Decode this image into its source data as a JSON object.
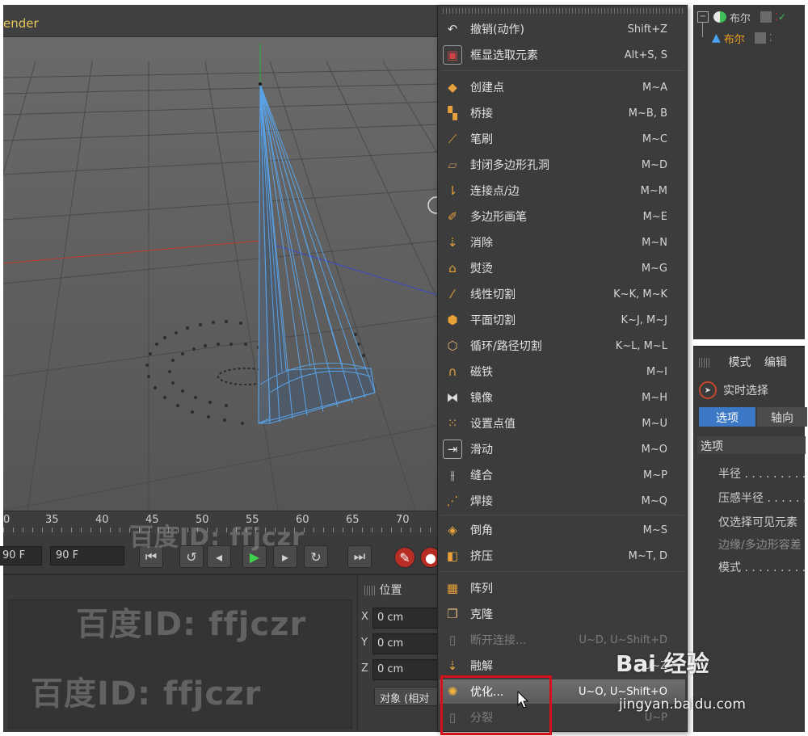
{
  "viewport": {
    "menu_text": "ender",
    "timeline_ticks": [
      "0",
      "35",
      "40",
      "45",
      "50",
      "55",
      "60",
      "65",
      "70"
    ]
  },
  "transport": {
    "start_frame": "90 F",
    "end_frame": "90 F"
  },
  "coordinates": {
    "title": "位置",
    "x_label": "X",
    "y_label": "Y",
    "z_label": "Z",
    "x_value": "0 cm",
    "y_value": "0 cm",
    "z_value": "0 cm",
    "mode_label": "对象 (相对"
  },
  "context_menu": {
    "items": [
      {
        "label": "撤销(动作)",
        "shortcut": "Shift+Z",
        "icon": "undo-icon"
      },
      {
        "label": "框显选取元素",
        "shortcut": "Alt+S, S",
        "icon": "frame-selection-icon"
      },
      {
        "label": "创建点",
        "shortcut": "M~A",
        "icon": "create-point-icon"
      },
      {
        "label": "桥接",
        "shortcut": "M~B, B",
        "icon": "bridge-icon"
      },
      {
        "label": "笔刷",
        "shortcut": "M~C",
        "icon": "brush-icon"
      },
      {
        "label": "封闭多边形孔洞",
        "shortcut": "M~D",
        "icon": "close-hole-icon"
      },
      {
        "label": "连接点/边",
        "shortcut": "M~M",
        "icon": "connect-icon"
      },
      {
        "label": "多边形画笔",
        "shortcut": "M~E",
        "icon": "polygon-pen-icon"
      },
      {
        "label": "消除",
        "shortcut": "M~N",
        "icon": "dissolve-icon"
      },
      {
        "label": "熨烫",
        "shortcut": "M~G",
        "icon": "iron-icon"
      },
      {
        "label": "线性切割",
        "shortcut": "K~K, M~K",
        "icon": "knife-icon"
      },
      {
        "label": "平面切割",
        "shortcut": "K~J, M~J",
        "icon": "plane-cut-icon"
      },
      {
        "label": "循环/路径切割",
        "shortcut": "K~L, M~L",
        "icon": "loop-cut-icon"
      },
      {
        "label": "磁铁",
        "shortcut": "M~I",
        "icon": "magnet-icon"
      },
      {
        "label": "镜像",
        "shortcut": "M~H",
        "icon": "mirror-icon"
      },
      {
        "label": "设置点值",
        "shortcut": "M~U",
        "icon": "set-point-value-icon"
      },
      {
        "label": "滑动",
        "shortcut": "M~O",
        "icon": "slide-icon"
      },
      {
        "label": "缝合",
        "shortcut": "M~P",
        "icon": "stitch-icon"
      },
      {
        "label": "焊接",
        "shortcut": "M~Q",
        "icon": "weld-icon"
      },
      {
        "label": "倒角",
        "shortcut": "M~S",
        "icon": "bevel-icon"
      },
      {
        "label": "挤压",
        "shortcut": "M~T, D",
        "icon": "extrude-icon"
      },
      {
        "label": "阵列",
        "shortcut": "",
        "icon": "array-icon"
      },
      {
        "label": "克隆",
        "shortcut": "",
        "icon": "clone-icon"
      },
      {
        "label": "断开连接...",
        "shortcut": "U~D, U~Shift+D",
        "icon": "disconnect-icon"
      },
      {
        "label": "融解",
        "shortcut": "U~Z",
        "icon": "melt-icon"
      },
      {
        "label": "优化...",
        "shortcut": "U~O, U~Shift+O",
        "icon": "optimize-icon"
      },
      {
        "label": "分裂",
        "shortcut": "U~P",
        "icon": "split-icon"
      }
    ]
  },
  "object_manager": {
    "objects": [
      {
        "name": "布尔"
      },
      {
        "name": "布尔"
      }
    ]
  },
  "attributes": {
    "tabs": [
      "模式",
      "编辑"
    ],
    "tool_name": "实时选择",
    "subtabs": [
      "选项",
      "轴向"
    ],
    "section": "选项",
    "rows": [
      "半径 . . . . . . . . .",
      "压感半径 . . . . . .",
      "仅选择可见元素",
      "边缘/多边形容差",
      "模式 . . . . . . . . ."
    ]
  },
  "watermark": {
    "text": "百度ID: ffjczr",
    "logo": "Bai 经验",
    "url": "jingyan.baidu.com"
  },
  "colors": {
    "accent_active": "#f0a11a",
    "highlight_box": "#d4111a",
    "axis_x": "#c0392b",
    "axis_y": "#2eae3a",
    "axis_z": "#3949c9"
  }
}
